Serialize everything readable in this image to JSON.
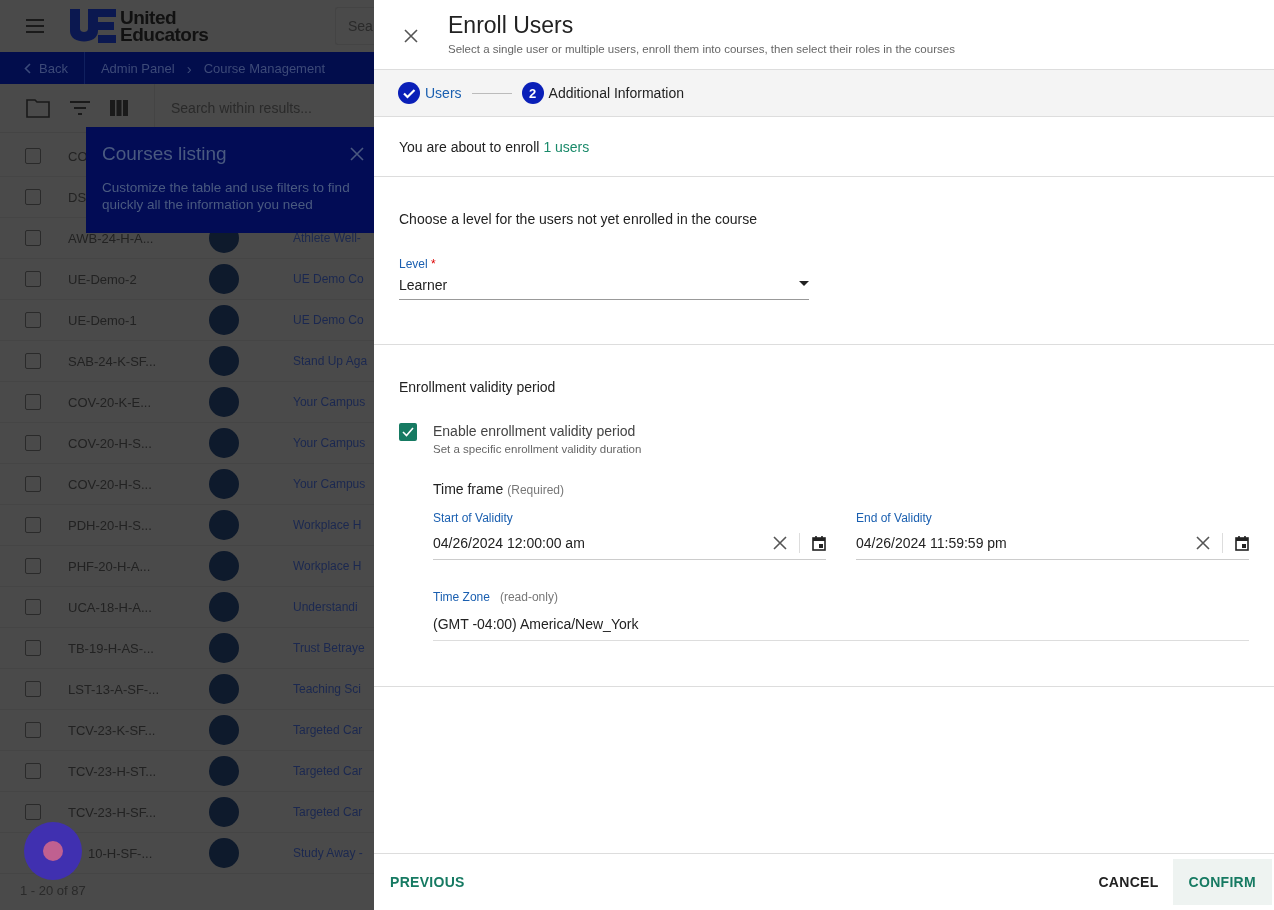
{
  "background_page": {
    "logo": {
      "line_1": "United",
      "line_2": "Educators"
    },
    "search_placeholder": "Sea",
    "breadcrumb": {
      "back": "Back",
      "items": [
        "Admin Panel",
        "Course Management"
      ],
      "separator": "›"
    },
    "toolbar": {
      "search_placeholder": "Search within results..."
    },
    "tooltip": {
      "title": "Courses listing",
      "text": "Customize the table and use filters to find quickly all the information you need"
    },
    "rows": [
      {
        "code": "CO",
        "checked": false
      },
      {
        "code": "DS",
        "checked": false
      },
      {
        "code": "AWB-24-H-A...",
        "title": "Athlete Well-",
        "checked": false
      },
      {
        "code": "UE-Demo-2",
        "title": "UE Demo Co",
        "checked": false
      },
      {
        "code": "UE-Demo-1",
        "title": "UE Demo Co",
        "checked": false
      },
      {
        "code": "SAB-24-K-SF...",
        "title": "Stand Up Aga",
        "checked": false
      },
      {
        "code": "COV-20-K-E...",
        "title": "Your Campus",
        "checked": false
      },
      {
        "code": "COV-20-H-S...",
        "title": "Your Campus",
        "checked": false
      },
      {
        "code": "COV-20-H-S...",
        "title": "Your Campus",
        "checked": false
      },
      {
        "code": "PDH-20-H-S...",
        "title": "Workplace H",
        "checked": false
      },
      {
        "code": "PHF-20-H-A...",
        "title": "Workplace H",
        "checked": false
      },
      {
        "code": "UCA-18-H-A...",
        "title": "Understandi",
        "checked": false
      },
      {
        "code": "TB-19-H-AS-...",
        "title": "Trust Betraye",
        "checked": false
      },
      {
        "code": "LST-13-A-SF-...",
        "title": "Teaching Sci",
        "checked": false
      },
      {
        "code": "TCV-23-K-SF...",
        "title": "Targeted Car",
        "checked": false
      },
      {
        "code": "TCV-23-H-ST...",
        "title": "Targeted Car",
        "checked": false
      },
      {
        "code": "TCV-23-H-SF...",
        "title": "Targeted Car",
        "checked": false
      },
      {
        "code": "10-H-SF-...",
        "title": "Study Away -"
      }
    ],
    "pagination": "1 - 20 of 87"
  },
  "dialog": {
    "title": "Enroll Users",
    "subtitle": "Select a single user or multiple users, enroll them into courses, then select their roles in the courses",
    "steps": [
      {
        "label": "Users",
        "completed": true
      },
      {
        "number": "2",
        "label": "Additional Information",
        "completed": false
      }
    ],
    "summary": {
      "text": "You are about to enroll",
      "link": "1 users"
    },
    "level_section": {
      "heading": "Choose a level for the users not yet enrolled in the course",
      "field": {
        "label": "Level",
        "required_mark": "*",
        "value": "Learner"
      }
    },
    "validity_section": {
      "heading": "Enrollment validity period",
      "checkbox": {
        "label": "Enable enrollment validity period",
        "hint": "Set a specific enrollment validity duration",
        "checked": true
      },
      "time_frame": {
        "title": "Time frame",
        "note": "(Required)"
      },
      "start": {
        "label": "Start of Validity",
        "value": "04/26/2024 12:00:00 am"
      },
      "end": {
        "label": "End of Validity",
        "value": "04/26/2024 11:59:59 pm"
      },
      "time_zone": {
        "label": "Time Zone",
        "note": "(read-only)",
        "value": "(GMT -04:00) America/New_York"
      }
    },
    "footer": {
      "previous": "PREVIOUS",
      "cancel": "CANCEL",
      "confirm": "CONFIRM"
    }
  }
}
